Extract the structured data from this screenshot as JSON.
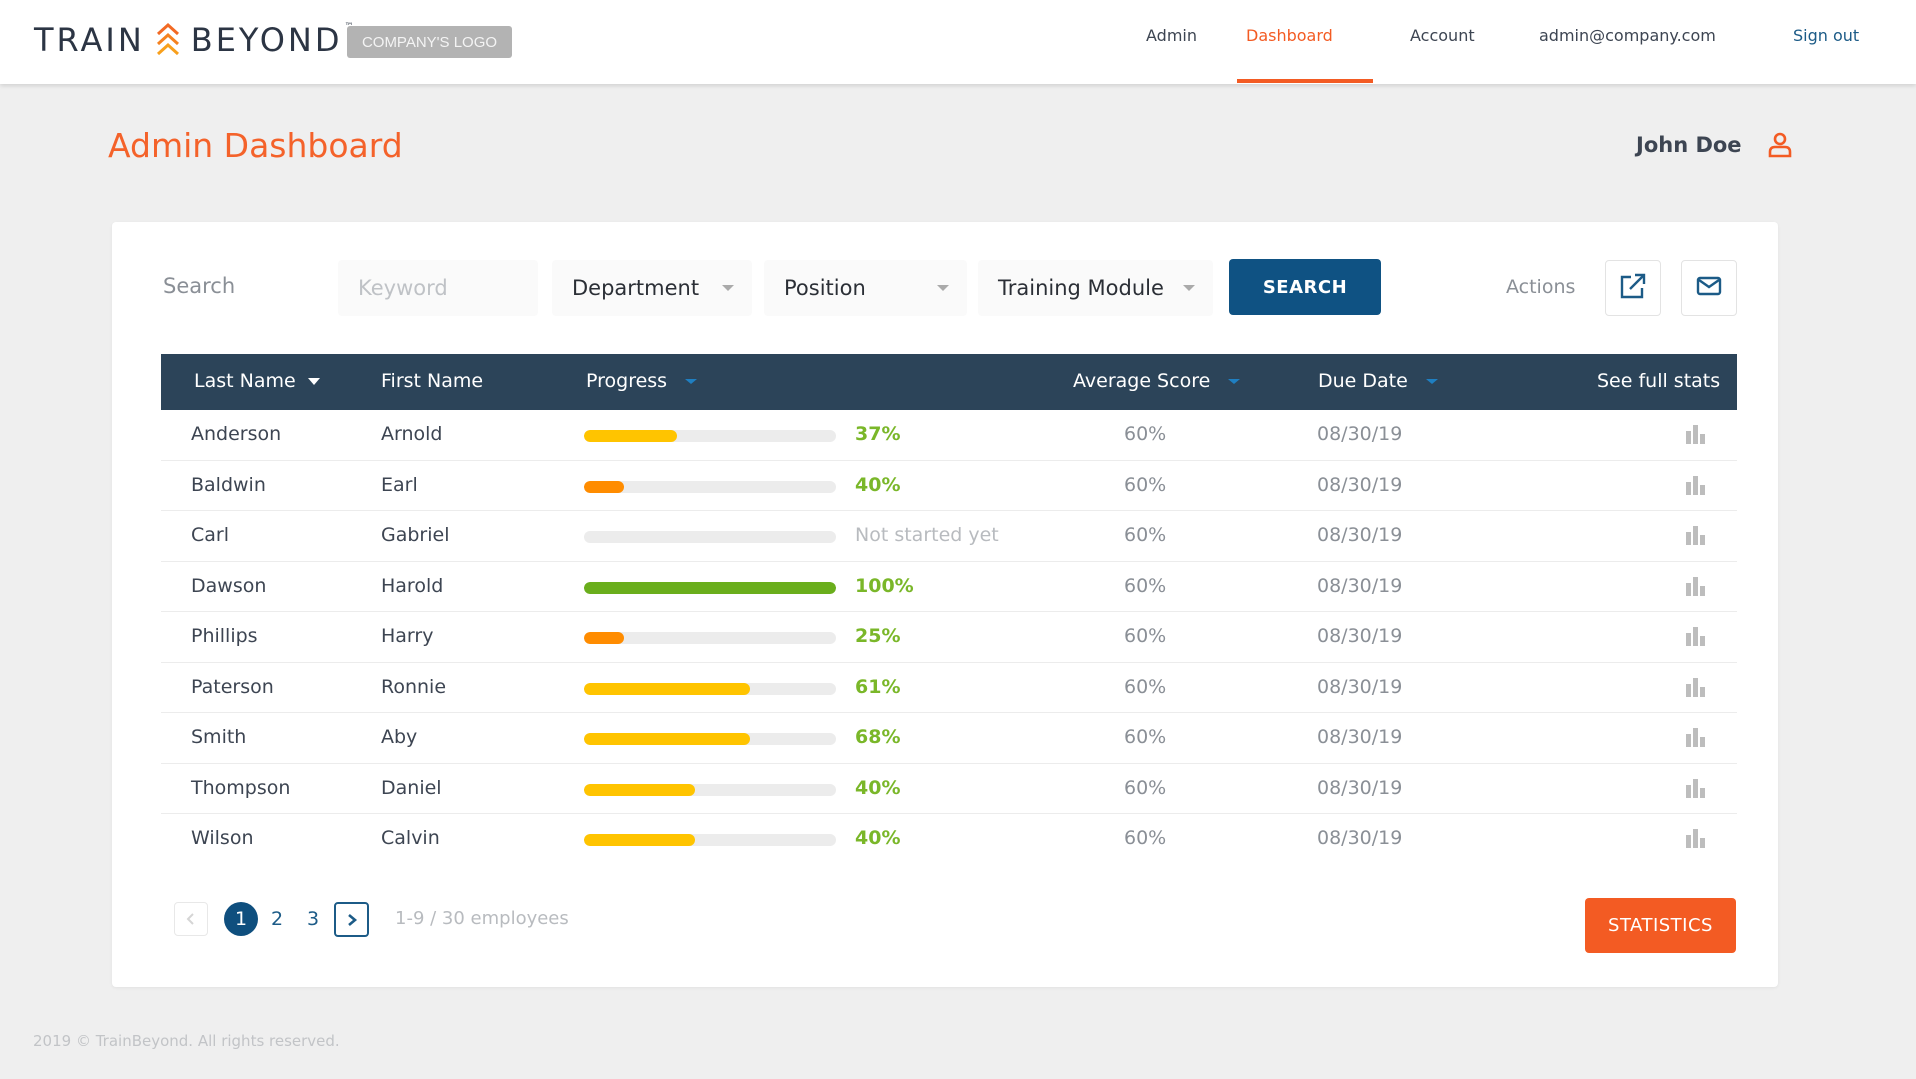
{
  "brand": {
    "left": "TRAIN",
    "right": "BEYOND",
    "tm": "™",
    "company_logo": "COMPANY'S LOGO"
  },
  "nav": {
    "items": [
      {
        "label": "Admin",
        "active": false
      },
      {
        "label": "Dashboard",
        "active": true
      },
      {
        "label": "Account",
        "active": false
      }
    ],
    "email": "admin@company.com",
    "signout": "Sign out"
  },
  "page": {
    "title": "Admin Dashboard",
    "user_name": "John Doe"
  },
  "filters": {
    "label": "Search",
    "keyword_placeholder": "Keyword",
    "keyword_value": "",
    "department": "Department",
    "position": "Position",
    "training_module": "Training Module",
    "search_button": "SEARCH",
    "actions_label": "Actions"
  },
  "table": {
    "headers": {
      "last_name": "Last Name",
      "first_name": "First Name",
      "progress": "Progress",
      "average_score": "Average Score",
      "due_date": "Due Date",
      "full_stats": "See full stats"
    },
    "rows": [
      {
        "last": "Anderson",
        "first": "Arnold",
        "progress": 37,
        "progress_label": "37%",
        "bar_color": "#ffc400",
        "avg": "60%",
        "due": "08/30/19"
      },
      {
        "last": "Baldwin",
        "first": "Earl",
        "progress": 40,
        "progress_label": "40%",
        "bar_color": "#ff8c00",
        "bar_fill": 16,
        "avg": "60%",
        "due": "08/30/19"
      },
      {
        "last": "Carl",
        "first": "Gabriel",
        "progress": 0,
        "progress_label": "Not started yet",
        "bar_color": "#ececec",
        "avg": "60%",
        "due": "08/30/19"
      },
      {
        "last": "Dawson",
        "first": "Harold",
        "progress": 100,
        "progress_label": "100%",
        "bar_color": "#6aae1c",
        "avg": "60%",
        "due": "08/30/19"
      },
      {
        "last": "Phillips",
        "first": "Harry",
        "progress": 25,
        "progress_label": "25%",
        "bar_color": "#ff8c00",
        "bar_fill": 16,
        "avg": "60%",
        "due": "08/30/19"
      },
      {
        "last": "Paterson",
        "first": "Ronnie",
        "progress": 61,
        "progress_label": "61%",
        "bar_color": "#ffc400",
        "bar_fill": 66,
        "avg": "60%",
        "due": "08/30/19"
      },
      {
        "last": "Smith",
        "first": "Aby",
        "progress": 68,
        "progress_label": "68%",
        "bar_color": "#ffc400",
        "bar_fill": 66,
        "avg": "60%",
        "due": "08/30/19"
      },
      {
        "last": "Thompson",
        "first": "Daniel",
        "progress": 40,
        "progress_label": "40%",
        "bar_color": "#ffc400",
        "bar_fill": 44,
        "avg": "60%",
        "due": "08/30/19"
      },
      {
        "last": "Wilson",
        "first": "Calvin",
        "progress": 40,
        "progress_label": "40%",
        "bar_color": "#ffc400",
        "bar_fill": 44,
        "avg": "60%",
        "due": "08/30/19"
      }
    ]
  },
  "pagination": {
    "pages": [
      "1",
      "2",
      "3"
    ],
    "current": "1",
    "summary": "1-9 / 30 employees"
  },
  "statistics_button": "STATISTICS",
  "footer": "2019 © TrainBeyond. All rights reserved.",
  "colors": {
    "accent": "#f35b23",
    "primary": "#0f5283",
    "header_bg": "#2c4459",
    "progress_text": "#7ab729"
  }
}
